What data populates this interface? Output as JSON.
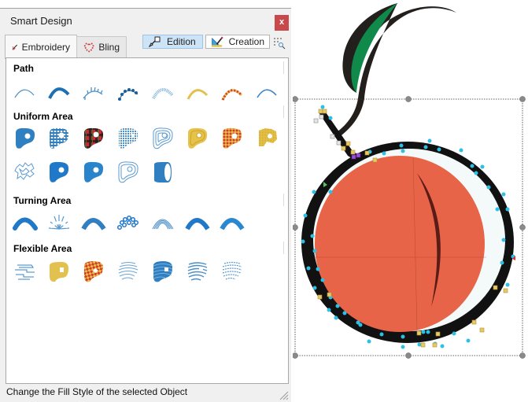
{
  "window": {
    "title": "Smart Design",
    "close_label": "x"
  },
  "tabs": [
    {
      "label": "Embroidery",
      "icon": "needle-icon",
      "active": true
    },
    {
      "label": "Bling",
      "icon": "heart-dots-icon",
      "active": false
    }
  ],
  "modes": {
    "edition": {
      "label": "Edition",
      "icon": "pointer-edit-icon",
      "active": true
    },
    "creation": {
      "label": "Creation",
      "icon": "set-square-pencil-icon",
      "active": false
    },
    "grid_search_icon": "grid-search-icon"
  },
  "sections": [
    {
      "title": "Path",
      "items": [
        "running-stitch",
        "satin-path",
        "e-stitch",
        "bead-path",
        "textured-path",
        "gold-satin-path",
        "bead-red-path",
        "thin-path"
      ]
    },
    {
      "title": "Uniform Area",
      "items": [
        "tatami-fill",
        "gingham-fill",
        "tartan-fill",
        "mesh-fill",
        "contour-fill",
        "gold-spiral-fill",
        "red-gold-fill",
        "gold-grid-fill",
        "stippling-fill",
        "blue-motif-fill",
        "blue-texture-fill",
        "outline-contour-fill",
        "3d-fill"
      ]
    },
    {
      "title": "Turning Area",
      "items": [
        "turning-satin",
        "radial-turning",
        "stripe-turning",
        "bead-turning",
        "multi-line-turning",
        "wave-turning",
        "texture-turning"
      ]
    },
    {
      "title": "Flexible Area",
      "items": [
        "maze-flex",
        "gold-flex",
        "checker-flex",
        "lines-flex",
        "wave-flex",
        "curve-flex",
        "dash-flex"
      ]
    }
  ],
  "status": {
    "text": "Change the Fill Style of the selected Object"
  },
  "colors": {
    "accent_blue": "#2f7fc1",
    "gold": "#e6c24a",
    "red": "#d63a2f",
    "close_red": "#c9494b",
    "peach": "#e86448",
    "leaf_green": "#0f8a4a"
  }
}
